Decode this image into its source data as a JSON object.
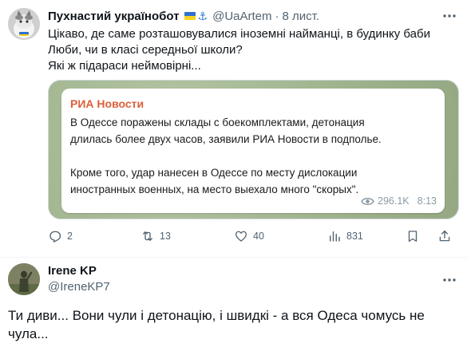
{
  "tweet1": {
    "author_name": "Пухнастий українобот",
    "handle": "@UaArtem",
    "separator": "·",
    "time": "8 лист.",
    "text_lines": [
      "Цікаво, де саме розташовувалися іноземні найманці, в будинку баби",
      "Люби, чи в класі середньої школи?",
      "Які ж підараси неймовірні..."
    ],
    "media_card": {
      "source": "РИА Новости",
      "paragraph1": [
        "В Одессе поражены склады с боекомплектами, детонация",
        "длилась более двух часов, заявили РИА Новости в подполье."
      ],
      "paragraph2": [
        "Кроме того, удар нанесен в Одессе по месту дислокации",
        "иностранных военных, на место выехало много \"скорых\"."
      ],
      "views": "296.1K",
      "time": "8:13"
    },
    "actions": {
      "replies": "2",
      "retweets": "13",
      "likes": "40",
      "views": "831"
    }
  },
  "tweet2": {
    "author_name": "Irene KP",
    "handle": "@IreneKP7",
    "text_lines": [
      "Ти диви... Вони чули і детонацію, і швидкі - а вся Одеса чомусь не",
      "чула..."
    ]
  },
  "colors": {
    "text": "#0f1419",
    "secondary": "#536471",
    "source_accent": "#dd5f3a",
    "flag_blue": "#2f6fd1",
    "flag_yellow": "#f6d41f"
  }
}
